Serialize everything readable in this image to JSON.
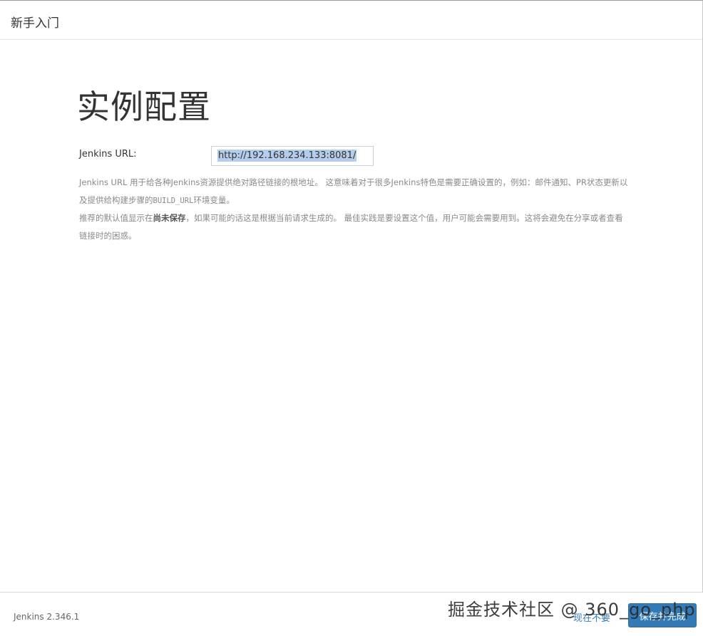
{
  "header": {
    "title": "新手入门"
  },
  "main": {
    "title": "实例配置",
    "url_label": "Jenkins URL:",
    "url_value": "http://192.168.234.133:8081/",
    "help1_a": "Jenkins URL 用于给各种Jenkins资源提供绝对路径链接的根地址。 这意味着对于很多Jenkins特色是需要正确设置的，例如：邮件通知、PR状态更新以及提供给构建步骤的",
    "help1_code": "BUILD_URL",
    "help1_b": "环境变量。",
    "help2_a": "推荐的默认值显示在",
    "help2_bold": "尚未保存",
    "help2_b": "，如果可能的话这是根据当前请求生成的。 最佳实践是要设置这个值，用户可能会需要用到。这将会避免在分享或者查看链接时的困惑。"
  },
  "footer": {
    "version": "Jenkins 2.346.1",
    "skip_label": "现在不要",
    "save_label": "保存并完成"
  },
  "watermark": "掘金技术社区 @ 360_go_php"
}
